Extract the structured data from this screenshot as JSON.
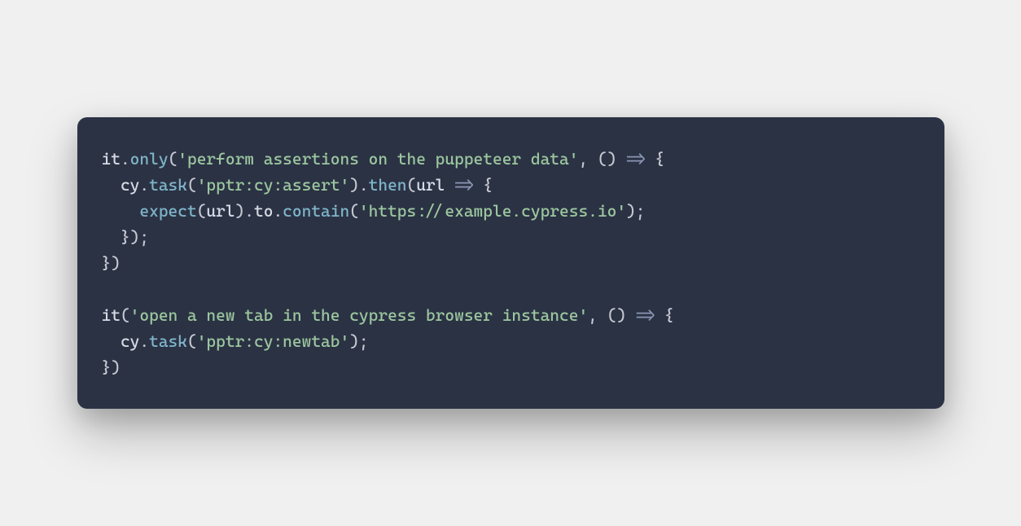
{
  "code": {
    "line1": {
      "it": "it",
      "dot1": ".",
      "only": "only",
      "paren1": "(",
      "str1": "'perform assertions on the puppeteer data'",
      "comma1": ", ",
      "paren2": "()",
      "arrow": " => ",
      "brace1": "{"
    },
    "line2": {
      "indent": "  ",
      "cy": "cy",
      "dot1": ".",
      "task": "task",
      "paren1": "(",
      "str1": "'pptr:cy:assert'",
      "paren2": ")",
      "dot2": ".",
      "then": "then",
      "paren3": "(",
      "url": "url",
      "arrow": " => ",
      "brace1": "{"
    },
    "line3": {
      "indent": "    ",
      "expect": "expect",
      "paren1": "(",
      "url": "url",
      "paren2": ")",
      "dot1": ".",
      "to": "to",
      "dot2": ".",
      "contain": "contain",
      "paren3": "(",
      "str1": "'https://example.cypress.io'",
      "paren4": ")",
      "semi": ";"
    },
    "line4": {
      "indent": "  ",
      "brace1": "}",
      "paren1": ")",
      "semi": ";"
    },
    "line5": {
      "brace1": "}",
      "paren1": ")"
    },
    "line6": {
      "blank": ""
    },
    "line7": {
      "it": "it",
      "paren1": "(",
      "str1": "'open a new tab in the cypress browser instance'",
      "comma1": ", ",
      "paren2": "()",
      "arrow": " => ",
      "brace1": "{"
    },
    "line8": {
      "indent": "  ",
      "cy": "cy",
      "dot1": ".",
      "task": "task",
      "paren1": "(",
      "str1": "'pptr:cy:newtab'",
      "paren2": ")",
      "semi": ";"
    },
    "line9": {
      "brace1": "}",
      "paren1": ")"
    }
  }
}
